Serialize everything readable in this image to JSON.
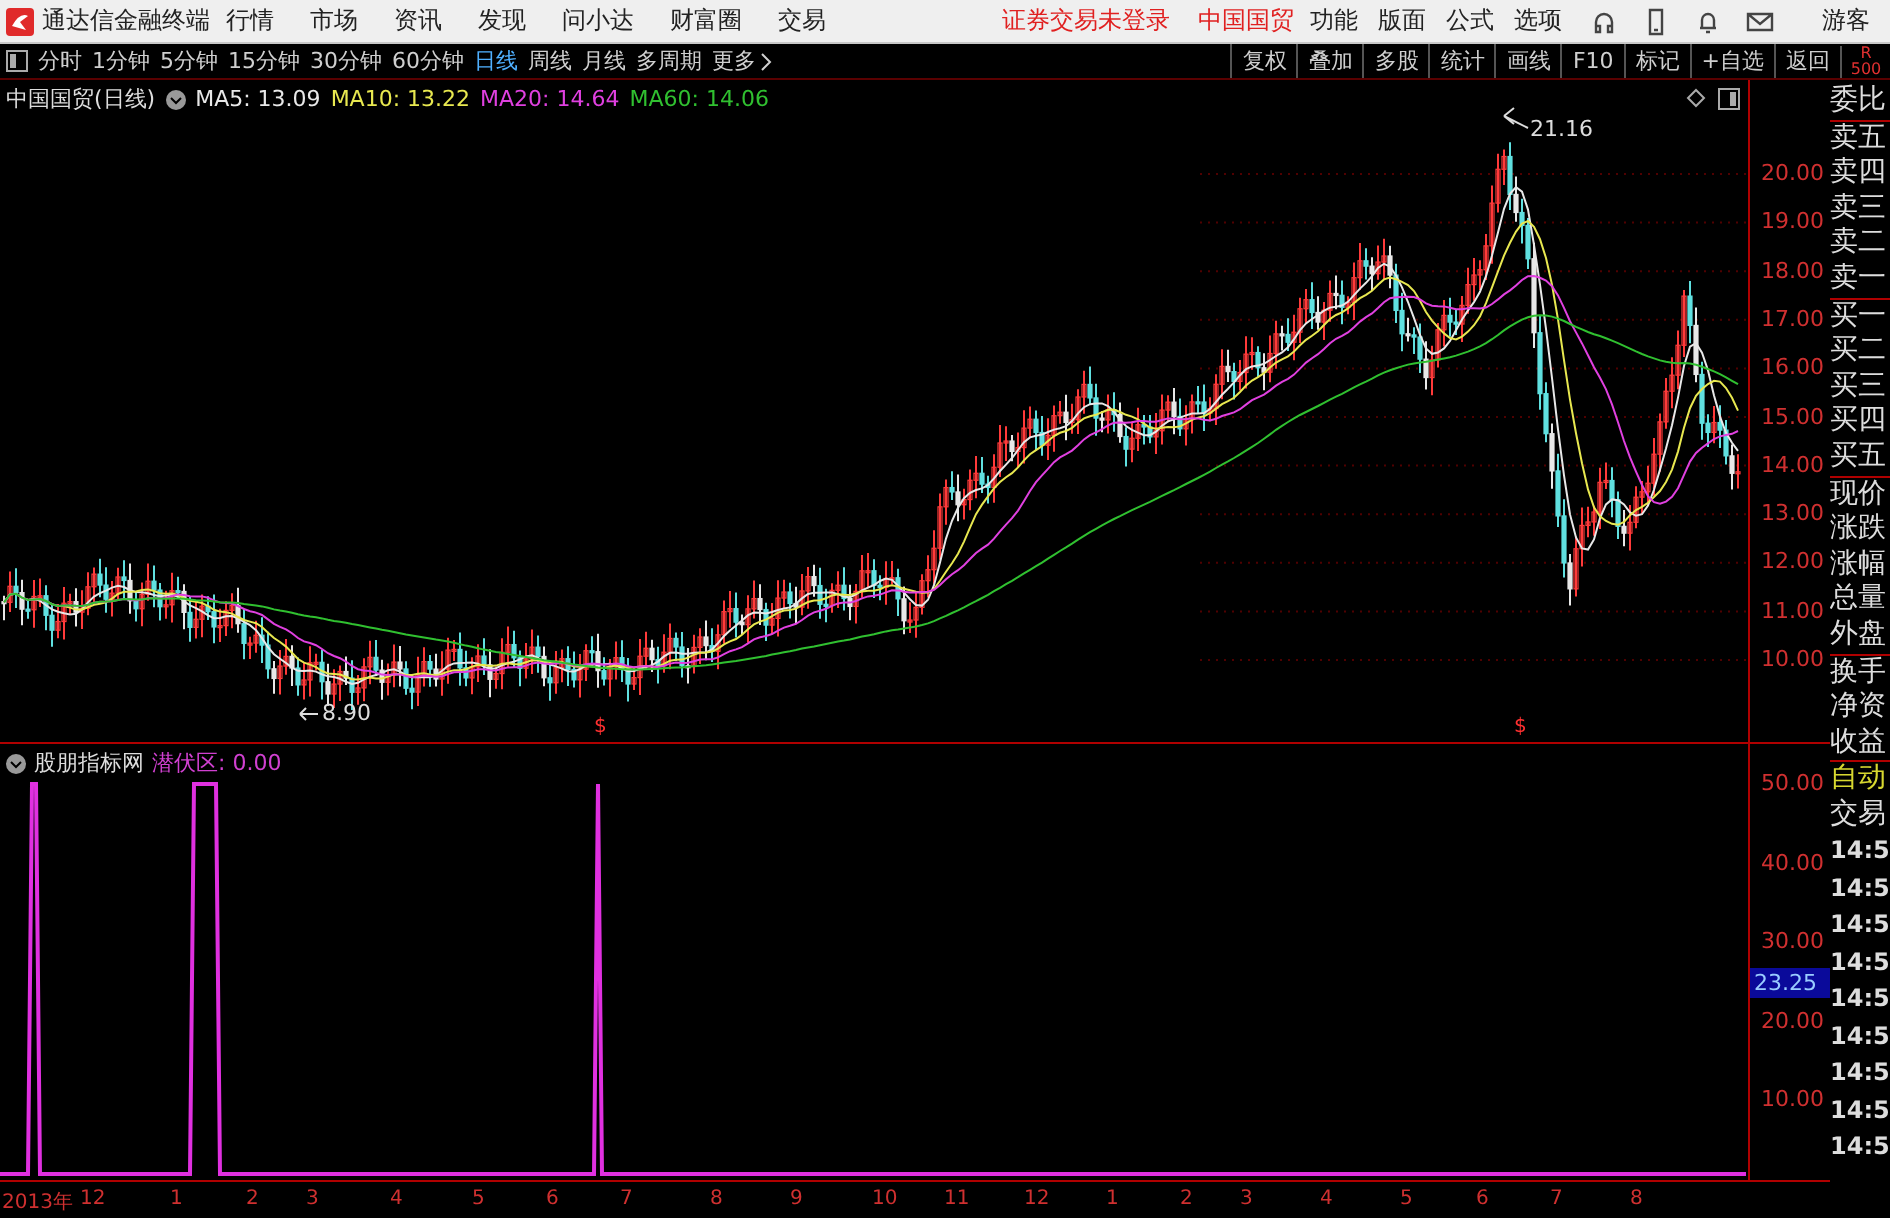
{
  "top_bar": {
    "app_title": "通达信金融终端",
    "menus": [
      "行情",
      "市场",
      "资讯",
      "发现",
      "问小达",
      "财富圈",
      "交易"
    ],
    "notices": [
      "证券交易未登录",
      "中国国贸"
    ],
    "tools": [
      "功能",
      "版面",
      "公式",
      "选项"
    ],
    "user": "游客"
  },
  "period_bar": {
    "periods": [
      {
        "label": "分时",
        "selected": false
      },
      {
        "label": "1分钟",
        "selected": false
      },
      {
        "label": "5分钟",
        "selected": false
      },
      {
        "label": "15分钟",
        "selected": false
      },
      {
        "label": "30分钟",
        "selected": false
      },
      {
        "label": "60分钟",
        "selected": false
      },
      {
        "label": "日线",
        "selected": true
      },
      {
        "label": "周线",
        "selected": false
      },
      {
        "label": "月线",
        "selected": false
      },
      {
        "label": "多周期",
        "selected": false
      }
    ],
    "more": "更多",
    "actions": [
      "复权",
      "叠加",
      "多股",
      "统计",
      "画线",
      "F10",
      "标记",
      "+自选",
      "返回"
    ],
    "corner": [
      "R",
      "500"
    ]
  },
  "price_chart": {
    "title": "中国国贸(日线)",
    "ma": [
      {
        "label": "MA5: 13.09",
        "color": "#e8e8e8"
      },
      {
        "label": "MA10: 13.22",
        "color": "#e8e850"
      },
      {
        "label": "MA20: 14.64",
        "color": "#e040e0"
      },
      {
        "label": "MA60: 14.06",
        "color": "#30c030"
      }
    ],
    "high_label": "21.16",
    "low_label": "8.90",
    "markers": [
      "$",
      "$"
    ],
    "axis": [
      "20.00",
      "19.00",
      "18.00",
      "17.00",
      "16.00",
      "15.00",
      "14.00",
      "13.00",
      "12.00",
      "11.00",
      "10.00"
    ]
  },
  "indicator": {
    "name": "股朋指标网",
    "reading": "潜伏区: 0.00",
    "axis": [
      "50.00",
      "40.00",
      "30.00",
      "20.00",
      "10.00"
    ],
    "current_value": "23.25"
  },
  "time_axis": [
    "2013年",
    "12",
    "1",
    "2",
    "3",
    "4",
    "5",
    "6",
    "7",
    "8",
    "9",
    "10",
    "11",
    "12",
    "1",
    "2",
    "3",
    "4",
    "5",
    "6",
    "7",
    "8"
  ],
  "side_panel": [
    {
      "kind": "label",
      "divider": false,
      "items": [
        "委比"
      ]
    },
    {
      "kind": "label",
      "divider": true,
      "items": [
        "卖五",
        "卖四",
        "卖三",
        "卖二",
        "卖一"
      ]
    },
    {
      "kind": "label",
      "divider": true,
      "items": [
        "买一",
        "买二",
        "买三",
        "买四",
        "买五"
      ]
    },
    {
      "kind": "label",
      "divider": true,
      "items": [
        "现价",
        "涨跌",
        "涨幅",
        "总量",
        "外盘"
      ]
    },
    {
      "kind": "label",
      "divider": true,
      "items": [
        "换手",
        "净资",
        "收益"
      ]
    },
    {
      "kind": "mode",
      "divider": true,
      "items": [
        "自动"
      ]
    },
    {
      "kind": "label",
      "divider": false,
      "items": [
        "交易"
      ]
    },
    {
      "kind": "time",
      "divider": false,
      "items": [
        "14:5",
        "14:5",
        "14:5",
        "14:5",
        "14:5",
        "14:5",
        "14:5",
        "14:5",
        "14:5"
      ]
    }
  ]
}
